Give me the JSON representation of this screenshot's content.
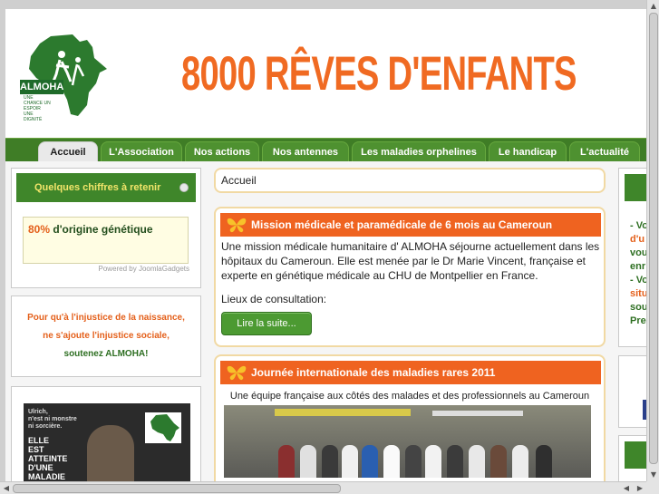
{
  "header": {
    "logo_text": "ALMOHA",
    "logo_tagline": "UNE CHANCE UN ESPOIR UNE DIGNITÉ",
    "title": "8000 RÊVES D'ENFANTS"
  },
  "nav": {
    "tabs": [
      {
        "label": "Accueil",
        "active": true
      },
      {
        "label": "L'Association",
        "active": false
      },
      {
        "label": "Nos actions",
        "active": false
      },
      {
        "label": "Nos antennes",
        "active": false
      },
      {
        "label": "Les maladies orphelines",
        "active": false
      },
      {
        "label": "Le handicap",
        "active": false
      },
      {
        "label": "L'actualité",
        "active": false
      }
    ]
  },
  "left": {
    "chiffres_title": "Quelques chiffres à retenir",
    "gadget_pct": "80%",
    "gadget_text": " d'origine génétique",
    "powered": "Powered by JoomlaGadgets",
    "slogan_line1": "Pour qu'à l'injustice de la naissance,",
    "slogan_line2": "ne s'ajoute l'injustice sociale,",
    "slogan_line3": "soutenez ALMOHA!",
    "poster_small": "Ulrich,\nn'est ni monstre\nni sorcière.",
    "poster_big": "ELLE\nEST\nATTEINTE\nD'UNE\nMALADIE\nRARE"
  },
  "breadcrumb": "Accueil",
  "articles": {
    "a1": {
      "title": "Mission médicale et paramédicale de 6 mois au Cameroun",
      "body": "Une mission médicale humanitaire d' ALMOHA séjourne actuellement dans les hôpitaux du Cameroun. Elle est menée par le Dr Marie Vincent, française et experte en génétique médicale au CHU de Montpellier en France.",
      "body2": "Lieux de consultation:",
      "readmore": "Lire la suite..."
    },
    "a2": {
      "title": "Journée internationale des maladies rares 2011",
      "subtitle": "Une équipe française aux côtés des malades et des professionnels au Cameroun"
    }
  },
  "right": {
    "l1": "- Vo",
    "l2": "d'u",
    "l3": "vou",
    "l4": "enr",
    "l5": "- Vo",
    "l6": "situ",
    "l7": "sou",
    "l8": "Pre"
  },
  "colors": {
    "brand_orange": "#ef6320",
    "brand_green": "#3f862a",
    "nav_green": "#3f7d26"
  }
}
